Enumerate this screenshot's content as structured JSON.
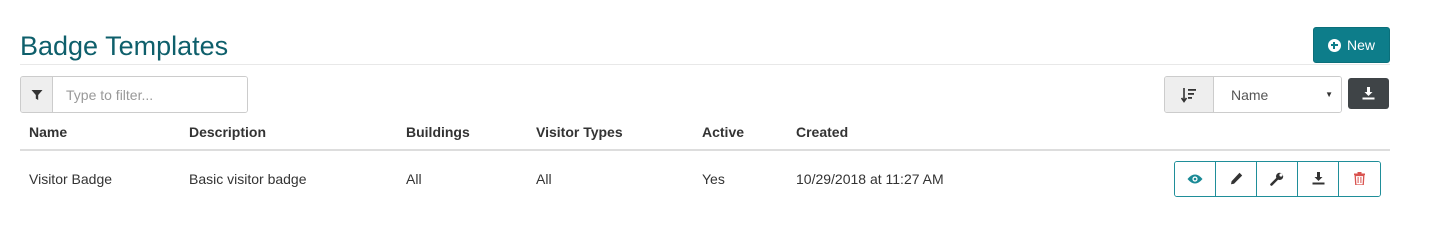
{
  "header": {
    "title": "Badge Templates",
    "new_button_label": "New",
    "accent_color": "#0d7d8a"
  },
  "toolbar": {
    "filter_placeholder": "Type to filter...",
    "filter_icon": "filter-icon",
    "sort_icon": "sort-amount-icon",
    "sort_value": "Name",
    "export_icon": "download-icon"
  },
  "table": {
    "columns": [
      "Name",
      "Description",
      "Buildings",
      "Visitor Types",
      "Active",
      "Created"
    ],
    "rows": [
      {
        "name": "Visitor Badge",
        "description": "Basic visitor badge",
        "buildings": "All",
        "visitor_types": "All",
        "active": "Yes",
        "created": "10/29/2018 at 11:27 AM",
        "actions": [
          "eye-icon",
          "pencil-icon",
          "wrench-icon",
          "download-icon",
          "trash-icon"
        ]
      }
    ]
  }
}
